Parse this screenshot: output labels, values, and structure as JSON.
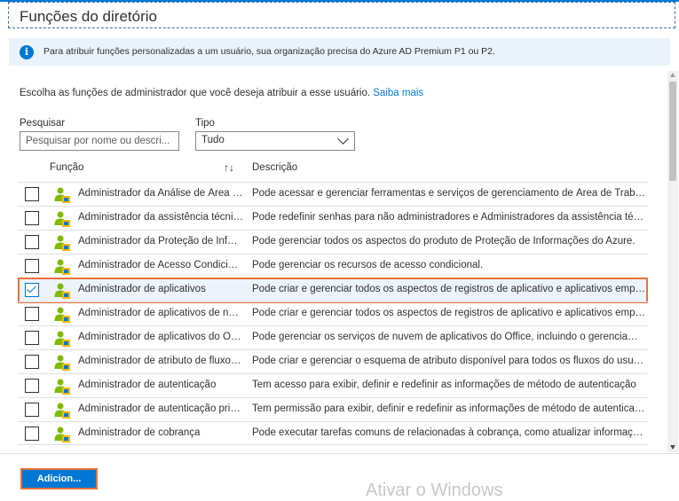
{
  "panel": {
    "title": "Funções do diretório"
  },
  "info": {
    "text": "Para atribuir funções personalizadas a um usuário, sua organização precisa do Azure AD Premium P1 ou P2."
  },
  "intro": {
    "text": "Escolha as funções de administrador que você deseja atribuir a esse usuário.",
    "link": "Saiba mais"
  },
  "filters": {
    "search_label": "Pesquisar",
    "search_placeholder": "Pesquisar por nome ou descri...",
    "type_label": "Tipo",
    "type_value": "Tudo"
  },
  "table": {
    "col_role": "Função",
    "col_desc": "Descrição",
    "rows": [
      {
        "name": "Administrador da Análise de Área de Trabalho",
        "desc": "Pode acessar e gerenciar ferramentas e serviços de gerenciamento de Área de Trabalho",
        "checked": false
      },
      {
        "name": "Administrador da assistência técnica",
        "desc": "Pode redefinir senhas para não administradores e Administradores da assistência técnica",
        "checked": false
      },
      {
        "name": "Administrador da Proteção de Informações",
        "desc": "Pode gerenciar todos os aspectos do produto de Proteção de Informações do Azure.",
        "checked": false
      },
      {
        "name": "Administrador de Acesso Condicional",
        "desc": "Pode gerenciar os recursos de acesso condicional.",
        "checked": false
      },
      {
        "name": "Administrador de aplicativos",
        "desc": "Pode criar e gerenciar todos os aspectos de registros de aplicativo e aplicativos empresariais",
        "checked": true
      },
      {
        "name": "Administrador de aplicativos de nuvem",
        "desc": "Pode criar e gerenciar todos os aspectos de registros de aplicativo e aplicativos empresariais",
        "checked": false
      },
      {
        "name": "Administrador de aplicativos do Office",
        "desc": "Pode gerenciar os serviços de nuvem de aplicativos do Office, incluindo o gerenciamento",
        "checked": false
      },
      {
        "name": "Administrador de atributo de fluxos de usuário",
        "desc": "Pode criar e gerenciar o esquema de atributo disponível para todos os fluxos do usuário",
        "checked": false
      },
      {
        "name": "Administrador de autenticação",
        "desc": "Tem acesso para exibir, definir e redefinir as informações de método de autenticação",
        "checked": false
      },
      {
        "name": "Administrador de autenticação privilegiada",
        "desc": "Tem permissão para exibir, definir e redefinir as informações de método de autenticação",
        "checked": false
      },
      {
        "name": "Administrador de cobrança",
        "desc": "Pode executar tarefas comuns de relacionadas à cobrança, como atualizar informações",
        "checked": false
      }
    ]
  },
  "footer": {
    "add_label": "Adicion...",
    "watermark": "Ativar o Windows"
  },
  "colors": {
    "accent": "#0078d4",
    "highlight": "#e8703a",
    "info_bg": "#eaf3fb"
  }
}
